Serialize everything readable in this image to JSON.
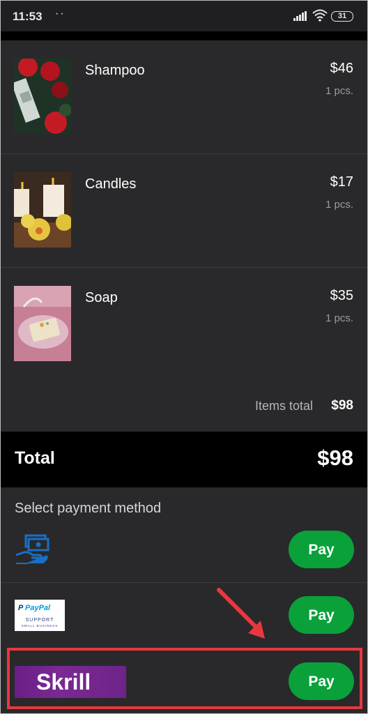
{
  "status_bar": {
    "time": "11:53",
    "dots": "⠈⠁",
    "battery": "31",
    "icons": [
      "signal-icon",
      "wifi-icon",
      "battery-icon"
    ]
  },
  "cart": {
    "items": [
      {
        "name": "Shampoo",
        "price": "$46",
        "qty": "1 pcs."
      },
      {
        "name": "Candles",
        "price": "$17",
        "qty": "1 pcs."
      },
      {
        "name": "Soap",
        "price": "$35",
        "qty": "1 pcs."
      }
    ],
    "items_total_label": "Items total",
    "items_total_value": "$98"
  },
  "total": {
    "label": "Total",
    "value": "$98"
  },
  "payment": {
    "title": "Select payment method",
    "methods": [
      {
        "name": "cash",
        "icon": "cash-hand-icon",
        "button": "Pay"
      },
      {
        "name": "PayPal",
        "logo_text": "PayPal",
        "support": "SUPPORT",
        "small_business": "SMALL BUSINESS",
        "button": "Pay"
      },
      {
        "name": "Skrill",
        "logo_text": "Skrill",
        "button": "Pay"
      }
    ]
  },
  "colors": {
    "accent_green": "#0aa13b",
    "highlight_red": "#e8373f",
    "background": "#29292b"
  }
}
